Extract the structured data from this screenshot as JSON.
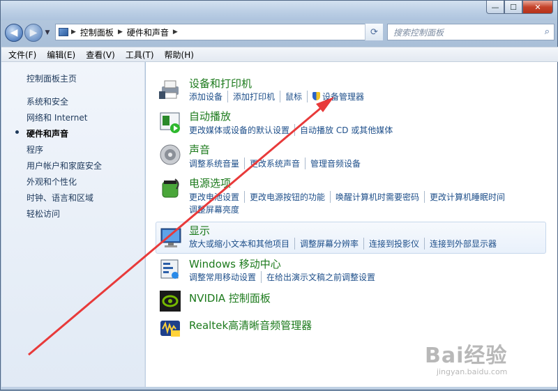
{
  "window": {
    "minimize": "—",
    "maximize": "☐",
    "close": "✕"
  },
  "nav": {
    "back": "◀",
    "forward": "▶",
    "breadcrumb": [
      "控制面板",
      "硬件和声音"
    ],
    "search_placeholder": "搜索控制面板"
  },
  "menu": [
    "文件(F)",
    "编辑(E)",
    "查看(V)",
    "工具(T)",
    "帮助(H)"
  ],
  "sidebar": {
    "home": "控制面板主页",
    "items": [
      "系统和安全",
      "网络和 Internet",
      "硬件和声音",
      "程序",
      "用户帐户和家庭安全",
      "外观和个性化",
      "时钟、语言和区域",
      "轻松访问"
    ],
    "active_index": 2
  },
  "categories": [
    {
      "title": "设备和打印机",
      "icon": "printer-icon",
      "links": [
        "添加设备",
        "添加打印机",
        "鼠标",
        "设备管理器"
      ]
    },
    {
      "title": "自动播放",
      "icon": "autoplay-icon",
      "links": [
        "更改媒体或设备的默认设置",
        "自动播放 CD 或其他媒体"
      ]
    },
    {
      "title": "声音",
      "icon": "speaker-icon",
      "links": [
        "调整系统音量",
        "更改系统声音",
        "管理音频设备"
      ]
    },
    {
      "title": "电源选项",
      "icon": "power-icon",
      "links": [
        "更改电池设置",
        "更改电源按钮的功能",
        "唤醒计算机时需要密码",
        "更改计算机睡眠时间"
      ],
      "links2": [
        "调整屏幕亮度"
      ]
    },
    {
      "title": "显示",
      "icon": "display-icon",
      "links": [
        "放大或缩小文本和其他项目",
        "调整屏幕分辨率",
        "连接到投影仪",
        "连接到外部显示器"
      ]
    },
    {
      "title": "Windows 移动中心",
      "icon": "mobility-center-icon",
      "links": [
        "调整常用移动设置",
        "在给出演示文稿之前调整设置"
      ]
    },
    {
      "title": "NVIDIA 控制面板",
      "icon": "nvidia-icon",
      "links": []
    },
    {
      "title": "Realtek高清晰音频管理器",
      "icon": "realtek-icon",
      "links": []
    }
  ],
  "watermark": {
    "big": "Bai经验",
    "small": "jingyan.baidu.com"
  },
  "colors": {
    "title_green": "#1c7a1c",
    "link_blue": "#1e4f8a",
    "annotation_red": "#e83a3a"
  }
}
